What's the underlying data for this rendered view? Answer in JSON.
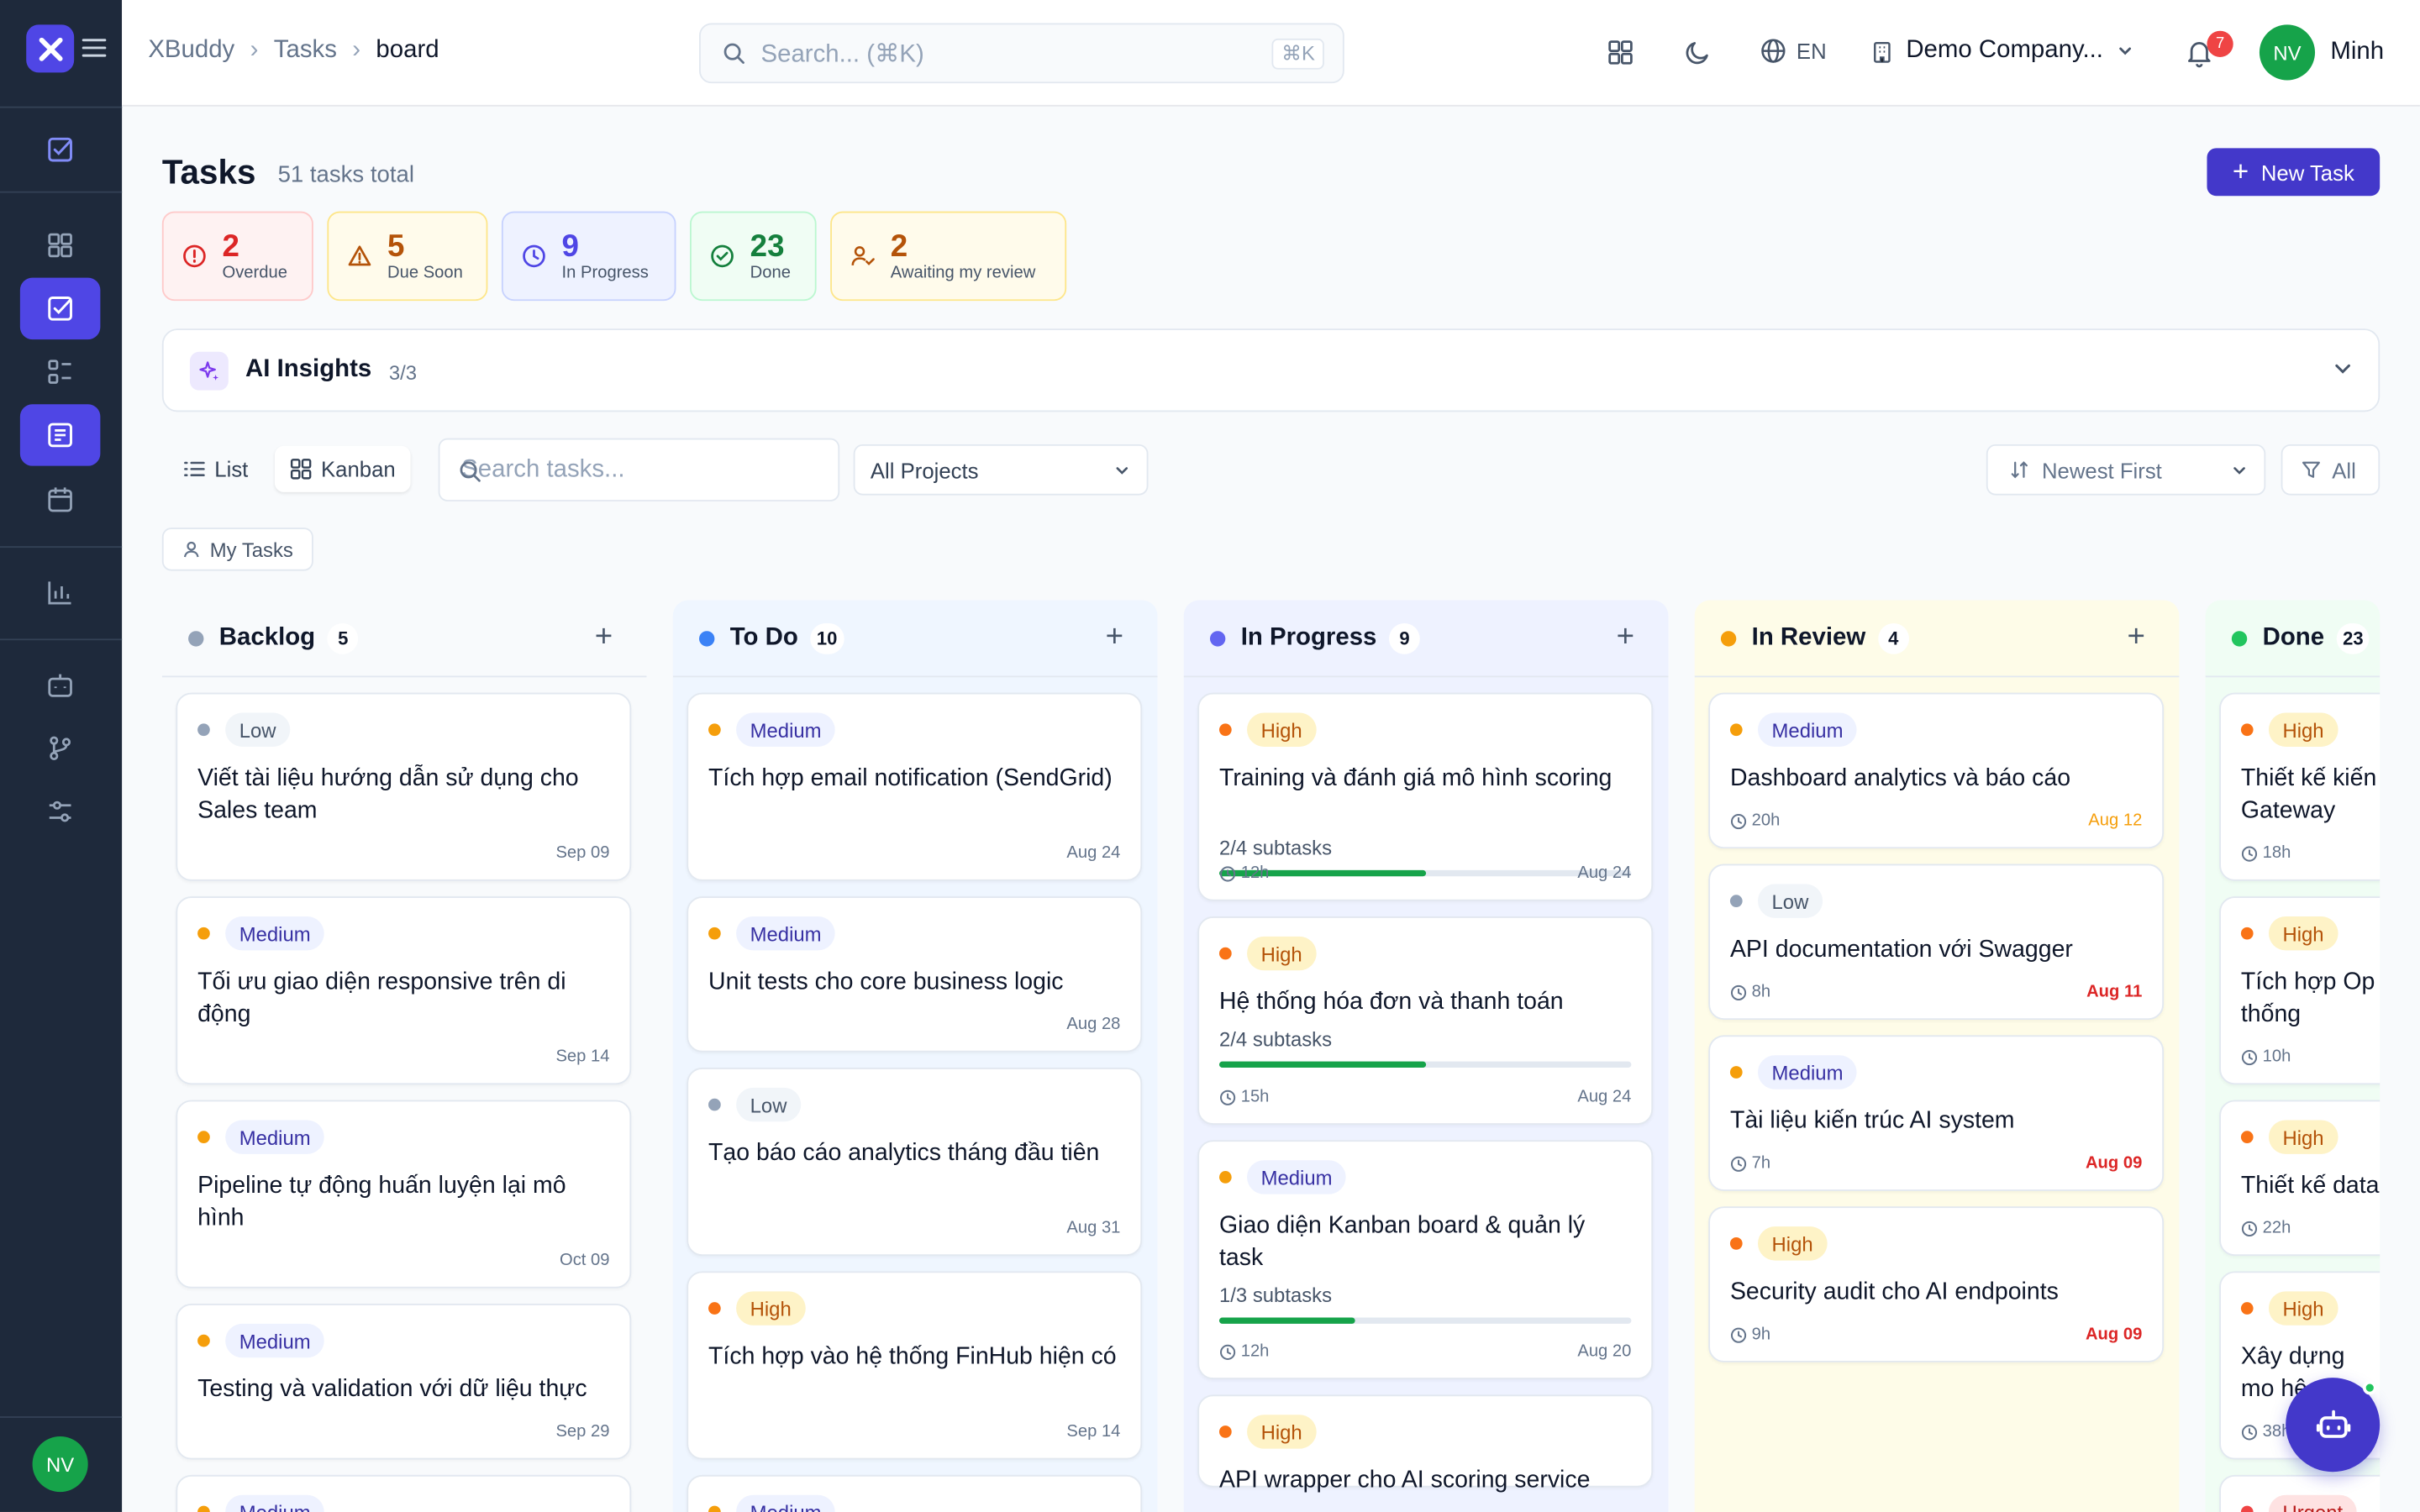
{
  "colors": {
    "sidebar_bg": "#1e293b",
    "accent": "#4f46e5",
    "green": "#16a34a",
    "priority": {
      "Low": "#94a3b8",
      "Medium": "#f59e0b",
      "High": "#f97316",
      "Urgent": "#ef4444"
    }
  },
  "app": {
    "logo_icon": "app-logo-icon"
  },
  "breadcrumb": [
    "XBuddy",
    "Tasks",
    "board"
  ],
  "header": {
    "search_placeholder": "Search... (⌘K)",
    "search_shortcut": "⌘K",
    "language": "EN",
    "company": "Demo Company...",
    "notification_count": "7",
    "user_initials": "NV",
    "user_name": "Minh"
  },
  "sidebar": {
    "items": [
      {
        "icon": "check-square-icon",
        "active": false
      },
      {
        "icon": "dashboard-icon",
        "active": false
      },
      {
        "icon": "check-square-icon",
        "active": true
      },
      {
        "icon": "list-icon",
        "active": false
      },
      {
        "icon": "document-icon",
        "active": true
      },
      {
        "icon": "calendar-icon",
        "active": false
      },
      {
        "icon": "chart-icon",
        "active": false
      },
      {
        "icon": "bot-icon",
        "active": false
      },
      {
        "icon": "git-branch-icon",
        "active": false
      },
      {
        "icon": "sliders-icon",
        "active": false
      }
    ],
    "user_initials": "NV"
  },
  "page": {
    "title": "Tasks",
    "subtitle": "51 tasks total",
    "new_task_label": "New Task"
  },
  "stats": [
    {
      "value": "2",
      "label": "Overdue"
    },
    {
      "value": "5",
      "label": "Due Soon"
    },
    {
      "value": "9",
      "label": "In Progress"
    },
    {
      "value": "23",
      "label": "Done"
    },
    {
      "value": "2",
      "label": "Awaiting my review"
    }
  ],
  "insights": {
    "title": "AI Insights",
    "count": "3/3"
  },
  "view": {
    "list_label": "List",
    "kanban_label": "Kanban",
    "search_placeholder": "Search tasks...",
    "project_filter": "All Projects",
    "sort": "Newest First",
    "filter": "All",
    "my_tasks": "My Tasks"
  },
  "columns": [
    {
      "name": "Backlog",
      "count": "5",
      "color": "#94a3b8",
      "cards": [
        {
          "priority": "Low",
          "title": "Viết tài liệu hướng dẫn sử dụng cho Sales team",
          "date": "Sep 09"
        },
        {
          "priority": "Medium",
          "title": "Tối ưu giao diện responsive trên di động",
          "date": "Sep 14"
        },
        {
          "priority": "Medium",
          "title": "Pipeline tự động huấn luyện lại mô hình",
          "date": "Oct 09"
        },
        {
          "priority": "Medium",
          "title": "Testing và validation với dữ liệu thực",
          "date": "Sep 29"
        },
        {
          "priority": "Medium",
          "title": "",
          "date": ""
        }
      ]
    },
    {
      "name": "To Do",
      "count": "10",
      "color": "#3b82f6",
      "cards": [
        {
          "priority": "Medium",
          "title": "Tích hợp email notification (SendGrid)",
          "date": "Aug 24"
        },
        {
          "priority": "Medium",
          "title": "Unit tests cho core business logic",
          "date": "Aug 28"
        },
        {
          "priority": "Low",
          "title": "Tạo báo cáo analytics tháng đầu tiên",
          "date": "Aug 31"
        },
        {
          "priority": "High",
          "title": "Tích hợp vào hệ thống FinHub hiện có",
          "date": "Sep 14"
        },
        {
          "priority": "Medium",
          "title": "",
          "date": ""
        }
      ]
    },
    {
      "name": "In Progress",
      "count": "9",
      "color": "#6366f1",
      "cards": [
        {
          "priority": "High",
          "title": "Training và đánh giá mô hình scoring",
          "subtasks": "2/4 subtasks",
          "progress": 0.5,
          "time": "12h",
          "date": "Aug 24"
        },
        {
          "priority": "High",
          "title": "Hệ thống hóa đơn và thanh toán",
          "subtasks": "2/4 subtasks",
          "progress": 0.5,
          "time": "15h",
          "date": "Aug 24"
        },
        {
          "priority": "Medium",
          "title": "Giao diện Kanban board & quản lý task",
          "subtasks": "1/3 subtasks",
          "progress": 0.33,
          "time": "12h",
          "date": "Aug 20"
        },
        {
          "priority": "High",
          "title": "API wrapper cho AI scoring service",
          "date": ""
        }
      ]
    },
    {
      "name": "In Review",
      "count": "4",
      "color": "#f59e0b",
      "cards": [
        {
          "priority": "Medium",
          "title": "Dashboard analytics và báo cáo",
          "time": "20h",
          "date": "Aug 12"
        },
        {
          "priority": "Low",
          "title": "API documentation với Swagger",
          "time": "8h",
          "date": "Aug 11"
        },
        {
          "priority": "Medium",
          "title": "Tài liệu kiến trúc AI system",
          "time": "7h",
          "date": "Aug 09"
        },
        {
          "priority": "High",
          "title": "Security audit cho AI endpoints",
          "time": "9h",
          "date": "Aug 09"
        }
      ]
    },
    {
      "name": "Done",
      "count": "23",
      "color": "#22c55e",
      "cards": [
        {
          "priority": "High",
          "title": "Thiết kế kiến Gateway",
          "time": "18h"
        },
        {
          "priority": "High",
          "title": "Tích hợp Op thống",
          "time": "10h"
        },
        {
          "priority": "High",
          "title": "Thiết kế data",
          "time": "22h"
        },
        {
          "priority": "High",
          "title": "Xây dựng mo hệ",
          "time": "38h"
        },
        {
          "priority": "Urgent",
          "title": "",
          "time": ""
        }
      ]
    }
  ]
}
